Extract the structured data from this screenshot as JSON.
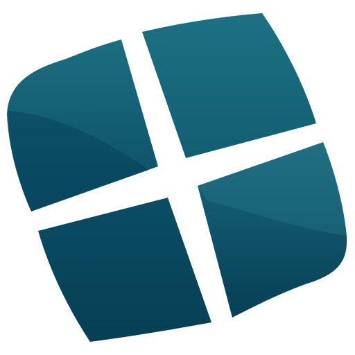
{
  "logo": {
    "icon": "four-pane-window-icon",
    "colors": {
      "background": "#ffffff",
      "pane_light": "#1c6e80",
      "pane_mid": "#125e73",
      "pane_dark": "#053f55",
      "gap": "#ffffff"
    }
  }
}
